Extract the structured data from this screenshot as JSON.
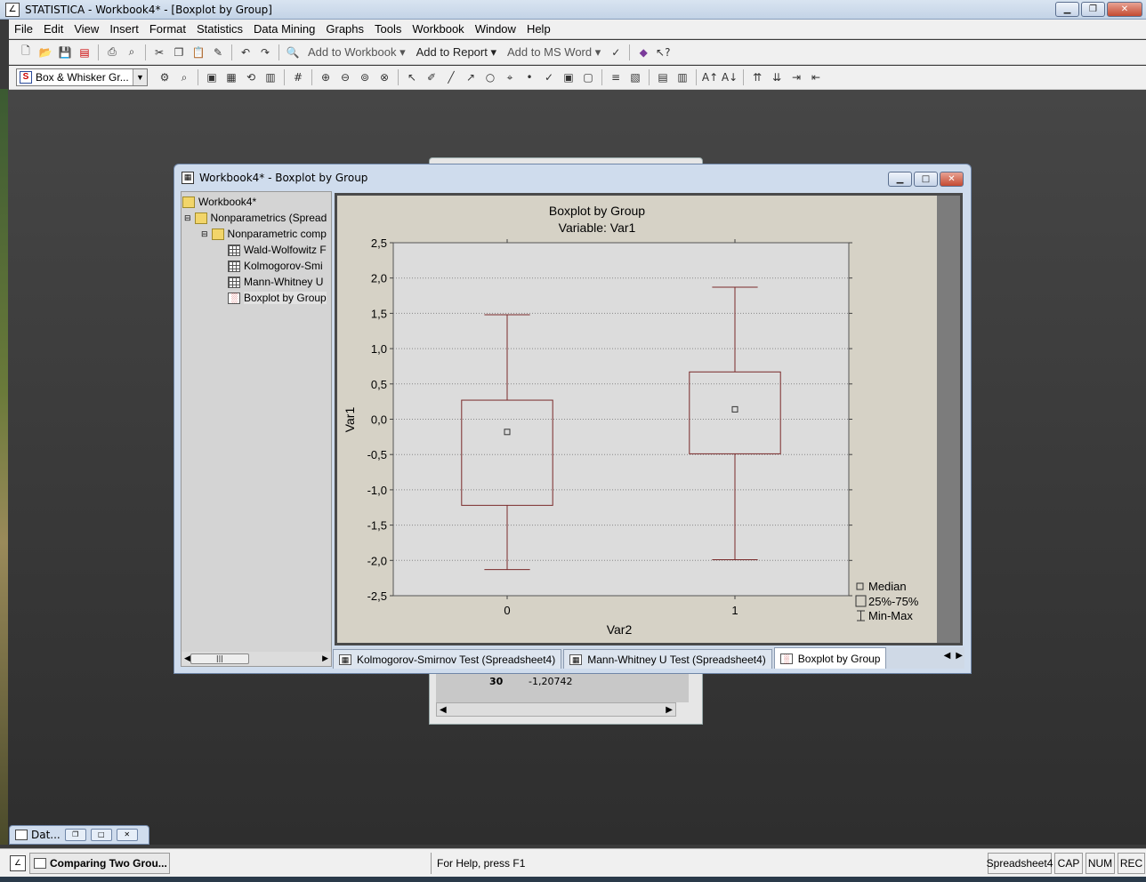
{
  "app": {
    "title": "STATISTICA - Workbook4* - [Boxplot by Group]"
  },
  "menu": [
    "File",
    "Edit",
    "View",
    "Insert",
    "Format",
    "Statistics",
    "Data Mining",
    "Graphs",
    "Tools",
    "Workbook",
    "Window",
    "Help"
  ],
  "toolbar1": {
    "add_to_workbook": "Add to Workbook",
    "add_to_report": "Add to Report",
    "add_to_ms_word": "Add to MS Word"
  },
  "toolbar2": {
    "graph_type_select": "Box & Whisker Gr..."
  },
  "background_sheet": {
    "row_number": "30",
    "cell_value": "-1,20742"
  },
  "workbook_window": {
    "title": "Workbook4* - Boxplot by Group",
    "tree": [
      {
        "label": "Workbook4*",
        "type": "folder"
      },
      {
        "label": "Nonparametrics (Spread",
        "type": "folder"
      },
      {
        "label": "Nonparametric comp",
        "type": "folder"
      },
      {
        "label": "Wald-Wolfowitz F",
        "type": "sheet"
      },
      {
        "label": "Kolmogorov-Smi",
        "type": "sheet"
      },
      {
        "label": "Mann-Whitney U",
        "type": "sheet"
      },
      {
        "label": "Boxplot by Group",
        "type": "graph"
      }
    ],
    "tabs": [
      {
        "label": "Kolmogorov-Smirnov Test (Spreadsheet4)",
        "active": false
      },
      {
        "label": "Mann-Whitney U Test (Spreadsheet4)",
        "active": false
      },
      {
        "label": "Boxplot by Group",
        "active": true
      }
    ]
  },
  "chart_data": {
    "type": "boxplot",
    "title": "Boxplot by Group",
    "subtitle": "Variable: Var1",
    "xlabel": "Var2",
    "ylabel": "Var1",
    "ylim": [
      -2.5,
      2.5
    ],
    "ytick_labels": [
      "2,5",
      "2,0",
      "1,5",
      "1,0",
      "0,5",
      "0,0",
      "-0,5",
      "-1,0",
      "-1,5",
      "-2,0",
      "-2,5"
    ],
    "yticks": [
      2.5,
      2.0,
      1.5,
      1.0,
      0.5,
      0.0,
      -0.5,
      -1.0,
      -1.5,
      -2.0,
      -2.5
    ],
    "grid": true,
    "categories": [
      "0",
      "1"
    ],
    "boxes": [
      {
        "category": "0",
        "min": -2.13,
        "q1": -1.22,
        "median": -0.18,
        "q3": 0.27,
        "max": 1.48
      },
      {
        "category": "1",
        "min": -1.99,
        "q1": -0.49,
        "median": 0.14,
        "q3": 0.67,
        "max": 1.87
      }
    ],
    "legend": {
      "placement": "bottom-right",
      "entries": [
        "Median",
        "25%-75%",
        "Min-Max"
      ]
    },
    "colors": {
      "box": "#7a2a2a",
      "plot_bg": "#dcdcdc",
      "frame_bg": "#d6d2c6"
    }
  },
  "minimized_window": {
    "title": "Dat..."
  },
  "statusbar": {
    "task": "Comparing Two Grou...",
    "help": "For Help, press F1",
    "panels": [
      "Spreadsheet4",
      "CAP",
      "NUM",
      "REC"
    ]
  }
}
